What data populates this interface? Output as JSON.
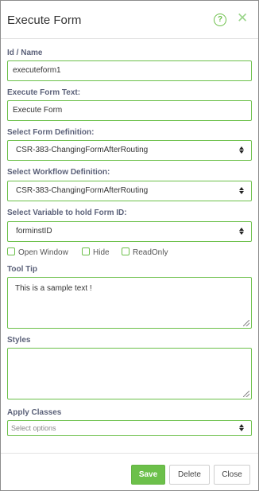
{
  "dialog": {
    "title": "Execute Form",
    "help_icon": "?",
    "close_icon": "✕"
  },
  "fields": {
    "id_name": {
      "label": "Id / Name",
      "value": "executeform1"
    },
    "execute_text": {
      "label": "Execute Form Text:",
      "value": "Execute Form"
    },
    "form_definition": {
      "label": "Select Form Definition:",
      "value": "CSR-383-ChangingFormAfterRouting"
    },
    "workflow_definition": {
      "label": "Select Workflow Definition:",
      "value": "CSR-383-ChangingFormAfterRouting"
    },
    "variable": {
      "label": "Select Variable to hold Form ID:",
      "value": "forminstID"
    }
  },
  "checkboxes": [
    {
      "label": "Open Window",
      "checked": false
    },
    {
      "label": "Hide",
      "checked": false
    },
    {
      "label": "ReadOnly",
      "checked": false
    }
  ],
  "tooltip": {
    "label": "Tool Tip",
    "value": "This is a sample text !"
  },
  "styles": {
    "label": "Styles",
    "value": ""
  },
  "apply_classes": {
    "label": "Apply Classes",
    "placeholder": "Select options"
  },
  "footer": {
    "save": "Save",
    "delete": "Delete",
    "close": "Close"
  },
  "colors": {
    "accent": "#6cc04a",
    "label": "#5b6179"
  }
}
